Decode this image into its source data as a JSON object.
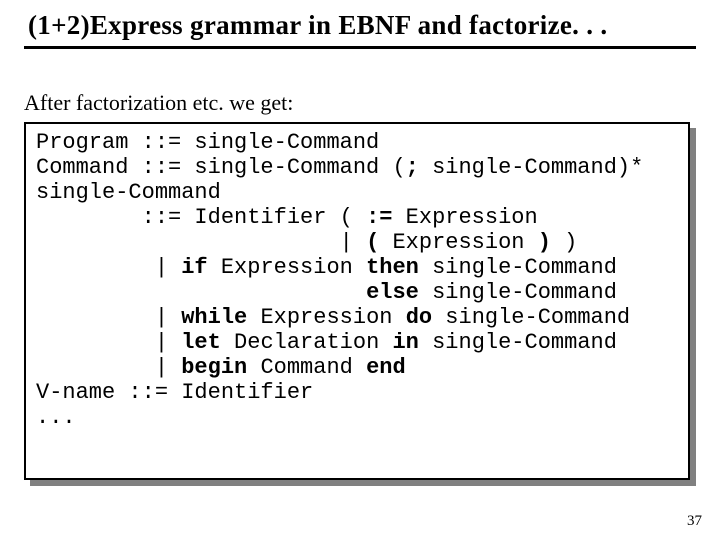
{
  "title": "(1+2)Express grammar in EBNF and factorize. . .",
  "intro": "After factorization etc. we get:",
  "code": {
    "l01a": "Program ::= single-Command",
    "l02a": "Command ::= single-Command (",
    "l02b": ";",
    "l02c": " single-Command)*",
    "l03a": "single-Command",
    "l04a": "        ::= Identifier ( ",
    "l04b": ":=",
    "l04c": " Expression",
    "l05a": "                       | ",
    "l05b": "(",
    "l05c": " Expression ",
    "l05d": ")",
    "l05e": " )",
    "l06a": "         |",
    "l06b": " if ",
    "l06c": "Expression ",
    "l06d": "then",
    "l06e": " single-Command",
    "l07a": "                         ",
    "l07b": "else",
    "l07c": " single-Command",
    "l08a": "         |",
    "l08b": " while ",
    "l08c": "Expression ",
    "l08d": "do",
    "l08e": " single-Command",
    "l09a": "         |",
    "l09b": " let ",
    "l09c": "Declaration ",
    "l09d": "in",
    "l09e": " single-Command",
    "l10a": "         |",
    "l10b": " begin ",
    "l10c": "Command ",
    "l10d": "end",
    "l11a": "V-name ::= Identifier",
    "l12a": "..."
  },
  "pagenum": "37"
}
